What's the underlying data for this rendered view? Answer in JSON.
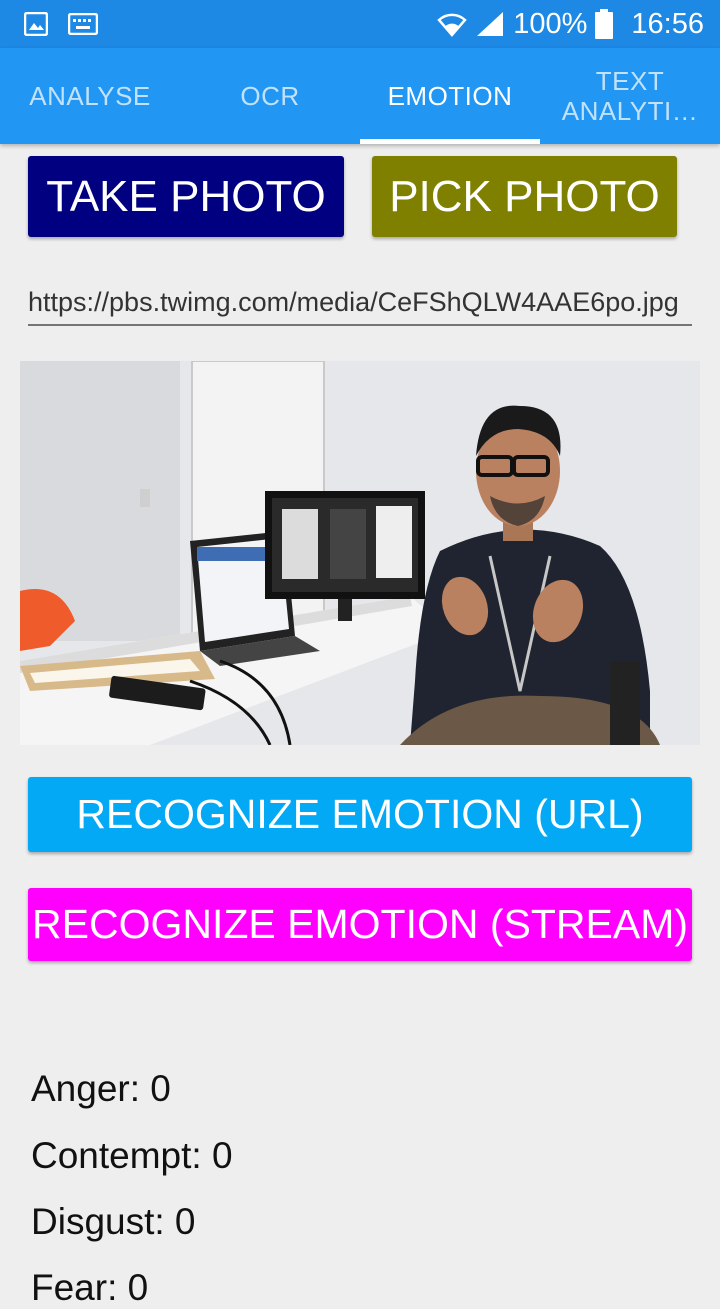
{
  "status_bar": {
    "battery": "100%",
    "time": "16:56",
    "icons": [
      "gallery-icon",
      "keyboard-icon",
      "wifi-icon",
      "signal-icon",
      "battery-icon"
    ]
  },
  "tabs": [
    {
      "label": "ANALYSE",
      "active": false
    },
    {
      "label": "OCR",
      "active": false
    },
    {
      "label": "EMOTION",
      "active": true
    },
    {
      "label": "TEXT ANALYTI…",
      "active": false
    }
  ],
  "buttons": {
    "take_photo": "TAKE PHOTO",
    "pick_photo": "PICK PHOTO",
    "recognize_url": "RECOGNIZE EMOTION (URL)",
    "recognize_stream": "RECOGNIZE EMOTION (STREAM)"
  },
  "url_field": {
    "value": "https://pbs.twimg.com/media/CeFShQLW4AAE6po.jpg"
  },
  "results": [
    {
      "label": "Anger: 0"
    },
    {
      "label": "Contempt: 0"
    },
    {
      "label": "Disgust: 0"
    },
    {
      "label": "Fear: 0"
    }
  ],
  "colors": {
    "status_bar": "#1e88e5",
    "tab_bar": "#2196f3",
    "take_photo": "#000080",
    "pick_photo": "#808000",
    "recognize_url": "#03a9f4",
    "recognize_stream": "#ff00ff"
  }
}
